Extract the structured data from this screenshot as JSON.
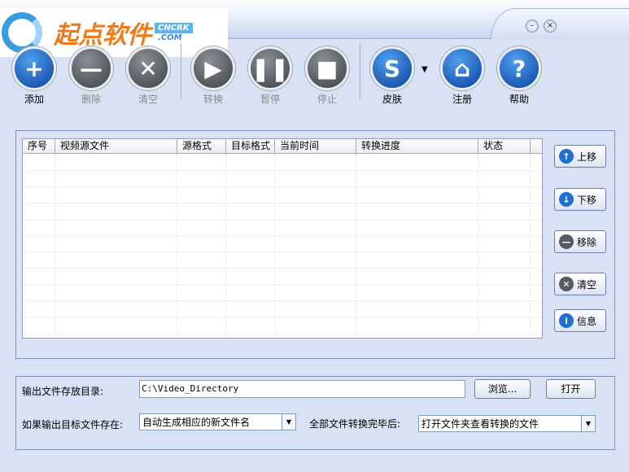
{
  "window": {
    "minimize": "–",
    "close": "×"
  },
  "logo": {
    "text": "起点软件",
    "badge": "CNCRK",
    ".com": ".COM"
  },
  "toolbar": [
    {
      "label": "添加",
      "glyph": "+",
      "enabled": true
    },
    {
      "label": "删除",
      "glyph": "—",
      "enabled": false
    },
    {
      "label": "清空",
      "glyph": "✕",
      "enabled": false
    },
    {
      "label": "转换",
      "glyph": "▶",
      "enabled": false
    },
    {
      "label": "暂停",
      "glyph": "❚❚",
      "enabled": false
    },
    {
      "label": "停止",
      "glyph": "■",
      "enabled": false
    },
    {
      "label": "皮肤",
      "glyph": "S",
      "enabled": true
    },
    {
      "label": "注册",
      "glyph": "⌂",
      "enabled": true
    },
    {
      "label": "帮助",
      "glyph": "?",
      "enabled": true
    }
  ],
  "skin_dropdown": "▼",
  "table": {
    "columns": [
      "序号",
      "视频源文件",
      "源格式",
      "目标格式",
      "当前时间",
      "转换进度",
      "状态"
    ],
    "rows": []
  },
  "side_buttons": [
    {
      "label": "上移",
      "glyph": "↑",
      "color": "#1f6fd0"
    },
    {
      "label": "下移",
      "glyph": "↓",
      "color": "#1f6fd0"
    },
    {
      "label": "移除",
      "glyph": "—",
      "color": "#555b63"
    },
    {
      "label": "清空",
      "glyph": "✕",
      "color": "#555b63"
    },
    {
      "label": "信息",
      "glyph": "i",
      "color": "#1f6fd0"
    }
  ],
  "output": {
    "dir_label": "输出文件存放目录:",
    "dir_value": "C:\\Video_Directory",
    "browse": "浏览...",
    "open": "打开",
    "exists_label": "如果输出目标文件存在:",
    "exists_value": "自动生成相应的新文件名",
    "after_label": "全部文件转换完毕后:",
    "after_value": "打开文件夹查看转换的文件",
    "arrow": "▼"
  }
}
